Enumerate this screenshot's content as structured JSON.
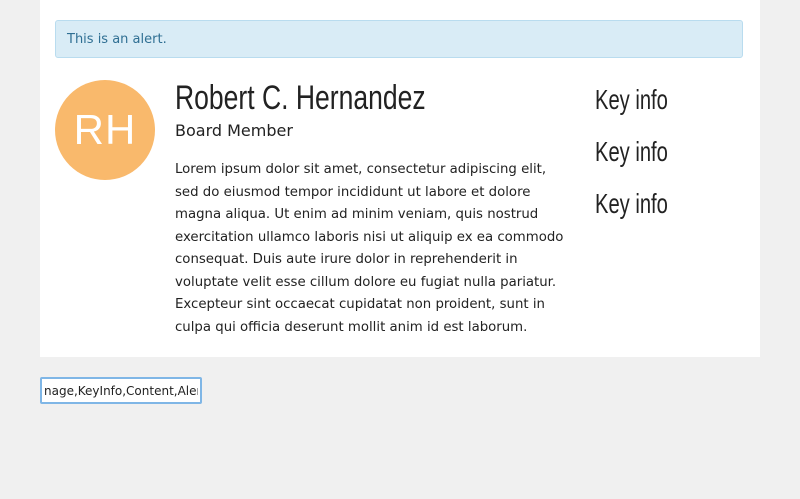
{
  "alert": {
    "text": "This is an alert."
  },
  "profile": {
    "initials": "RH",
    "name": "Robert C. Hernandez",
    "role": "Board Member",
    "bio": "Lorem ipsum dolor sit amet, consectetur adipiscing elit, sed do eiusmod tempor incididunt ut labore et dolore magna aliqua. Ut enim ad minim veniam, quis nostrud exercitation ullamco laboris nisi ut aliquip ex ea commodo consequat. Duis aute irure dolor in reprehenderit in voluptate velit esse cillum dolore eu fugiat nulla pariatur. Excepteur sint occaecat cupidatat non proident, sunt in culpa qui officia deserunt mollit anim id est laborum.",
    "avatar_color": "#f9b96c"
  },
  "key_info": [
    {
      "label": "Key info"
    },
    {
      "label": "Key info"
    },
    {
      "label": "Key info"
    }
  ],
  "layout_input": {
    "value": "nage,KeyInfo,Content,Alert"
  },
  "colors": {
    "page_bg": "#f0f0f0",
    "card_bg": "#ffffff",
    "alert_bg": "#d9ecf6",
    "alert_text": "#2f6f93",
    "input_border": "#7fb6e6"
  }
}
